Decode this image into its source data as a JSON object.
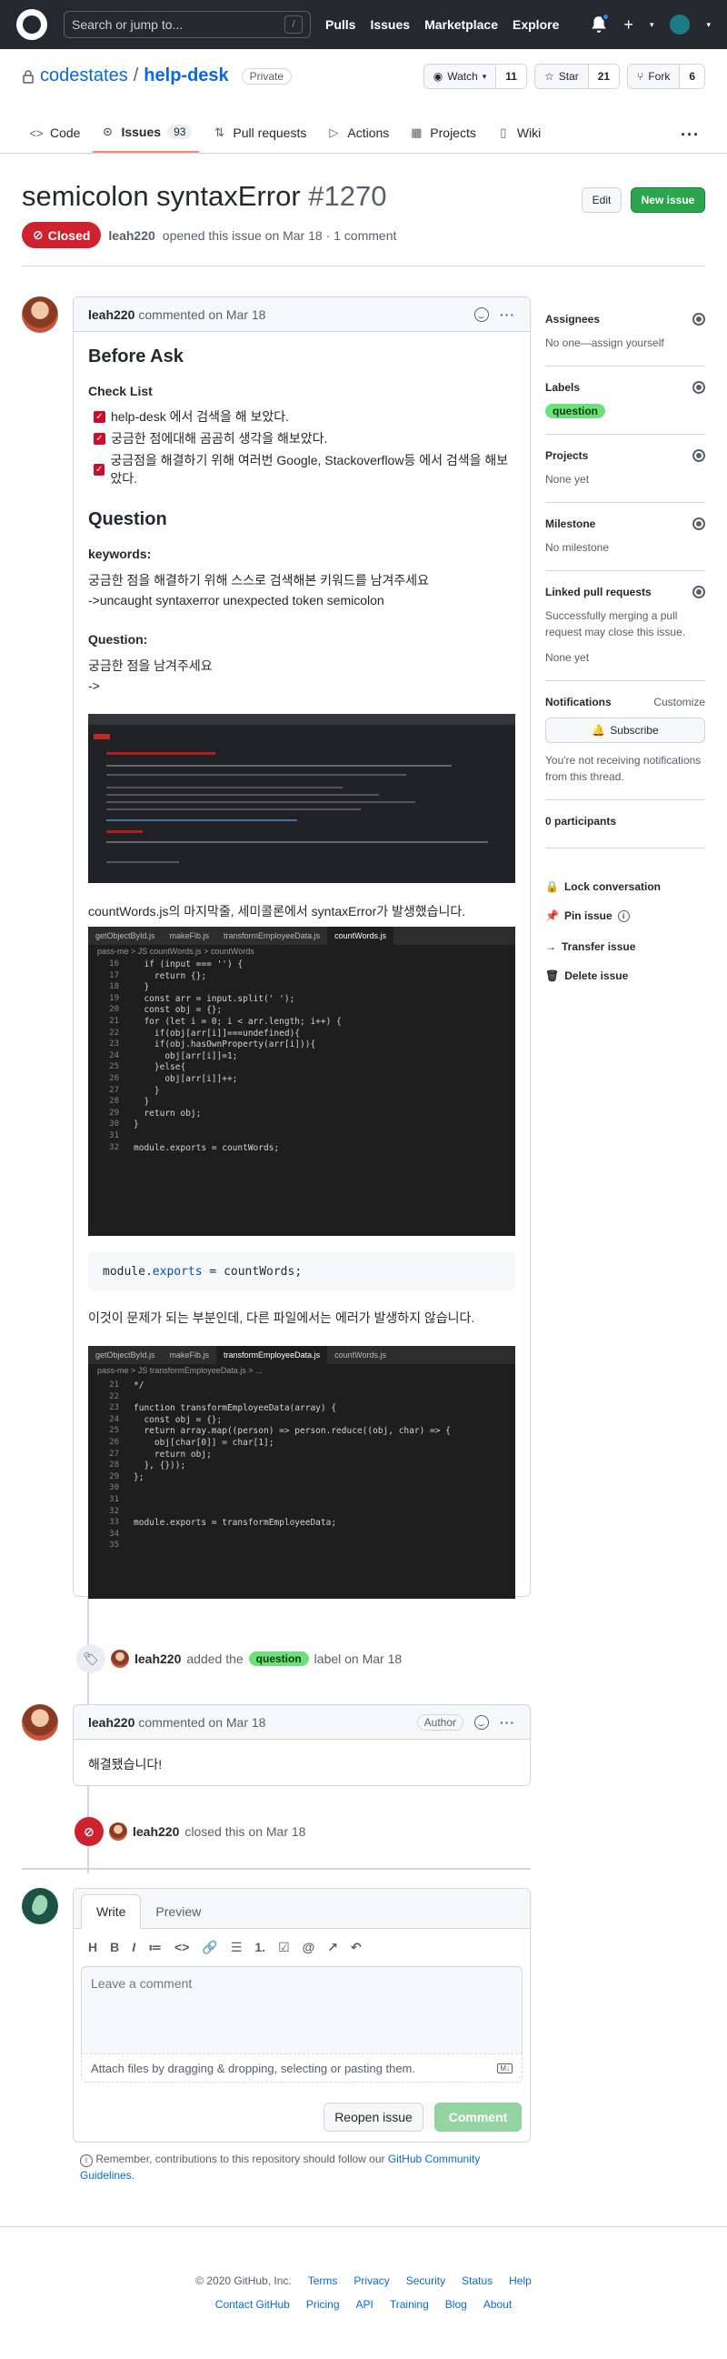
{
  "header": {
    "search_placeholder": "Search or jump to...",
    "search_shortcut": "/",
    "nav": [
      "Pulls",
      "Issues",
      "Marketplace",
      "Explore"
    ],
    "plus": "+"
  },
  "repo": {
    "owner": "codestates",
    "name": "help-desk",
    "visibility": "Private",
    "watch_label": "Watch",
    "watch_count": "11",
    "star_label": "Star",
    "star_count": "21",
    "fork_label": "Fork",
    "fork_count": "6",
    "tabs": [
      {
        "label": "Code",
        "icon": "code-icon"
      },
      {
        "label": "Issues",
        "count": "93",
        "icon": "issue-icon"
      },
      {
        "label": "Pull requests",
        "icon": "pull-request-icon"
      },
      {
        "label": "Actions",
        "icon": "actions-icon"
      },
      {
        "label": "Projects",
        "icon": "projects-icon"
      },
      {
        "label": "Wiki",
        "icon": "book-icon"
      }
    ],
    "more": "···"
  },
  "issue": {
    "title": "semicolon syntaxError",
    "number": "#1270",
    "edit_label": "Edit",
    "new_label": "New issue",
    "state": "Closed",
    "author": "leah220",
    "opened_text": "opened this issue on Mar 18 · 1 comment"
  },
  "comment1": {
    "author": "leah220",
    "meta": "commented on Mar 18",
    "h_before": "Before Ask",
    "h_checklist": "Check List",
    "checks": [
      "help-desk 에서 검색을 해 보았다.",
      "궁금한 점에대해 곰곰히 생각을 해보았다.",
      "궁금점을 해결하기 위해 여러번 Google, Stackoverflow등 에서 검색을 해보았다."
    ],
    "h_question": "Question",
    "h_keywords": "keywords:",
    "keywords_p1": "궁금한 점을 해결하기 위해 스스로 검색해본 키워드를 남겨주세요",
    "keywords_p2": "->uncaught syntaxerror unexpected token semicolon",
    "h_question2": "Question:",
    "question_p1": "궁금한 점을 남겨주세요",
    "question_p2": "->",
    "caption1": "countWords.js의 마지막줄, 세미콜론에서 syntaxError가 발생했습니다.",
    "code_module": "module",
    "code_exports": ".exports",
    "code_rest": " = countWords;",
    "caption2": "이것이 문제가 되는 부분인데, 다른 파일에서는 에러가 발생하지 않습니다."
  },
  "shot2": {
    "tabs": [
      "getObjectById.js",
      "makeFib.js",
      "transformEmployeeData.js",
      "countWords.js"
    ],
    "crumb": "pass-me > JS countWords.js > countWords",
    "lines": [
      "16",
      "17",
      "18",
      "19",
      "20",
      "21",
      "22",
      "23",
      "24",
      "25",
      "26",
      "27",
      "28",
      "29",
      "30",
      "31",
      "32"
    ],
    "code": [
      "  if (input === '') {",
      "    return {};",
      "  }",
      "  const arr = input.split(' ');",
      "  const obj = {};",
      "  for (let i = 0; i < arr.length; i++) {",
      "    if(obj[arr[i]]===undefined){",
      "    if(obj.hasOwnProperty(arr[i])){",
      "      obj[arr[i]]=1;",
      "    }else{",
      "      obj[arr[i]]++;",
      "    }",
      "  }",
      "  return obj;",
      "}",
      "",
      "module.exports = countWords;"
    ]
  },
  "shot3": {
    "tabs": [
      "getObjectById.js",
      "makeFib.js",
      "transformEmployeeData.js",
      "countWords.js"
    ],
    "crumb": "pass-me > JS transformEmployeeData.js > ...",
    "lines": [
      "21",
      "22",
      "23",
      "24",
      "25",
      "26",
      "27",
      "28",
      "29",
      "30",
      "31",
      "32",
      "33",
      "34",
      "35"
    ],
    "code": [
      "*/",
      "",
      "function transformEmployeeData(array) {",
      "  const obj = {};",
      "  return array.map((person) => person.reduce((obj, char) => {",
      "    obj[char[0]] = char[1];",
      "    return obj;",
      "  }, {}));",
      "};",
      "",
      "",
      "",
      "module.exports = transformEmployeeData;",
      "",
      ""
    ]
  },
  "event_label": {
    "author": "leah220",
    "pre": "added the",
    "label": "question",
    "post": "label on Mar 18"
  },
  "comment2": {
    "author": "leah220",
    "meta": "commented on Mar 18",
    "badge": "Author",
    "body": "해결됐습니다!"
  },
  "event_closed": {
    "author": "leah220",
    "text": "closed this on Mar 18"
  },
  "editor": {
    "write": "Write",
    "preview": "Preview",
    "tools": [
      "H",
      "B",
      "I",
      "≔",
      "<>",
      "🔗",
      "☰",
      "1.",
      "☑",
      "@",
      "↗",
      "↶"
    ],
    "placeholder": "Leave a comment",
    "attach": "Attach files by dragging & dropping, selecting or pasting them.",
    "reopen": "Reopen issue",
    "comment": "Comment",
    "remember_pre": "Remember, contributions to this repository should follow our",
    "remember_link": "GitHub Community Guidelines",
    "remember_post": "."
  },
  "sidebar": {
    "assignees": "Assignees",
    "assignees_val": "No one—assign yourself",
    "labels": "Labels",
    "label_val": "question",
    "projects": "Projects",
    "projects_val": "None yet",
    "milestone": "Milestone",
    "milestone_val": "No milestone",
    "linked": "Linked pull requests",
    "linked_val": "Successfully merging a pull request may close this issue.",
    "linked_none": "None yet",
    "notifications": "Notifications",
    "customize": "Customize",
    "subscribe": "Subscribe",
    "notif_text": "You're not receiving notifications from this thread.",
    "participants": "0 participants",
    "lock": "Lock conversation",
    "pin": "Pin issue",
    "transfer": "Transfer issue",
    "delete": "Delete issue"
  },
  "footer": {
    "row1": [
      "© 2020 GitHub, Inc.",
      "Terms",
      "Privacy",
      "Security",
      "Status",
      "Help"
    ],
    "row2": [
      "Contact GitHub",
      "Pricing",
      "API",
      "Training",
      "Blog",
      "About"
    ]
  },
  "colors": {
    "closed": "#cf222e",
    "green": "#2da44e",
    "label": "#6ee07a",
    "accent": "#fd8c73"
  }
}
